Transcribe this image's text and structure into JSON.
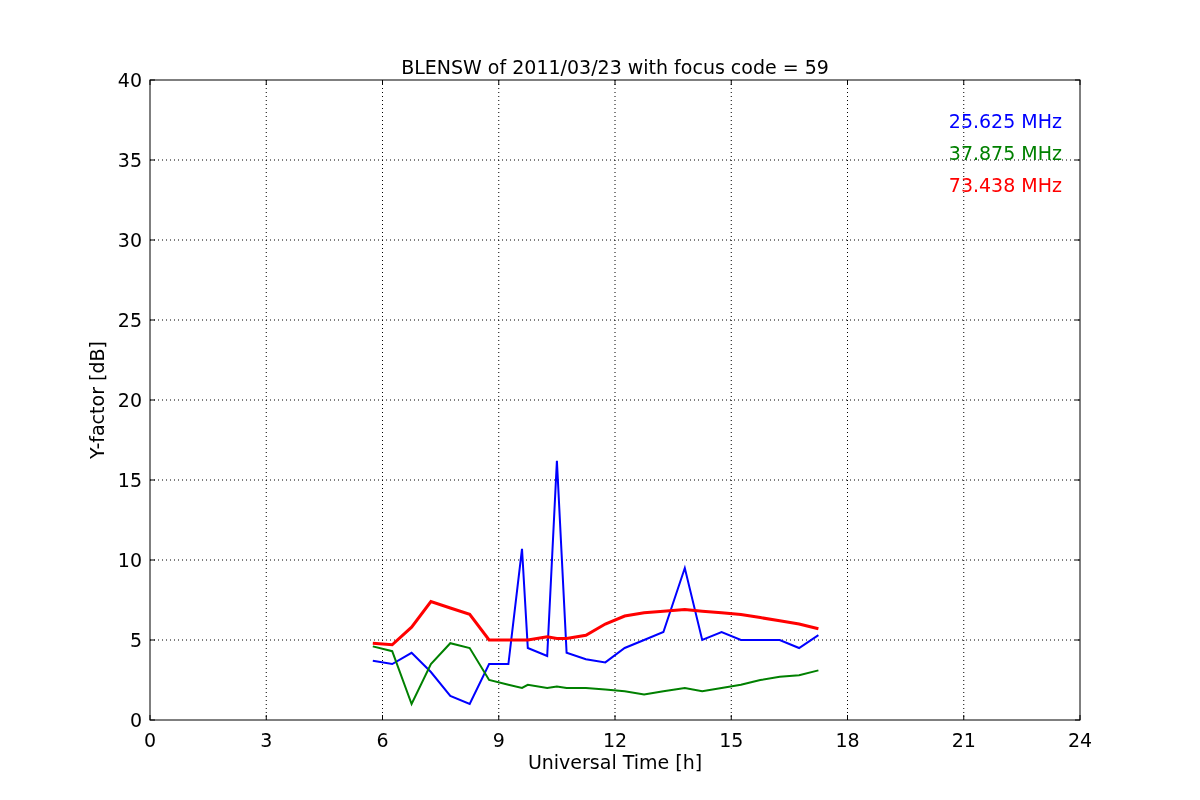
{
  "chart_data": {
    "type": "line",
    "title": "BLENSW of 2011/03/23 with focus code = 59",
    "xlabel": "Universal Time [h]",
    "ylabel": "Y-factor [dB]",
    "x": [
      5.75,
      6.25,
      6.75,
      7.25,
      7.75,
      8.25,
      8.75,
      9.25,
      9.6,
      9.75,
      10.25,
      10.5,
      10.75,
      11.25,
      11.75,
      12.25,
      12.75,
      13.25,
      13.8,
      14.25,
      14.75,
      15.25,
      15.75,
      16.25,
      16.75,
      17.25
    ],
    "series": [
      {
        "name": "25.625 MHz",
        "color": "#0000ff",
        "values": [
          3.7,
          3.5,
          4.2,
          3.0,
          1.5,
          1.0,
          3.5,
          3.5,
          10.7,
          4.5,
          4.0,
          16.2,
          4.2,
          3.8,
          3.6,
          4.5,
          5.0,
          5.5,
          9.5,
          5.0,
          5.5,
          5.0,
          5.0,
          5.0,
          4.5,
          5.3
        ]
      },
      {
        "name": "37.875 MHz",
        "color": "#008000",
        "values": [
          4.6,
          4.3,
          1.0,
          3.5,
          4.8,
          4.5,
          2.5,
          2.2,
          2.0,
          2.2,
          2.0,
          2.1,
          2.0,
          2.0,
          1.9,
          1.8,
          1.6,
          1.8,
          2.0,
          1.8,
          2.0,
          2.2,
          2.5,
          2.7,
          2.8,
          3.1
        ]
      },
      {
        "name": "73.438 MHz",
        "color": "#ff0000",
        "values": [
          4.8,
          4.7,
          5.8,
          7.4,
          7.0,
          6.6,
          5.0,
          5.0,
          5.0,
          5.0,
          5.2,
          5.1,
          5.1,
          5.3,
          6.0,
          6.5,
          6.7,
          6.8,
          6.9,
          6.8,
          6.7,
          6.6,
          6.4,
          6.2,
          6.0,
          5.7
        ]
      }
    ],
    "xlim": [
      0,
      24
    ],
    "ylim": [
      0,
      40
    ],
    "xticks": [
      0,
      3,
      6,
      9,
      12,
      15,
      18,
      21,
      24
    ],
    "yticks": [
      0,
      5,
      10,
      15,
      20,
      25,
      30,
      35,
      40
    ],
    "grid": true
  }
}
